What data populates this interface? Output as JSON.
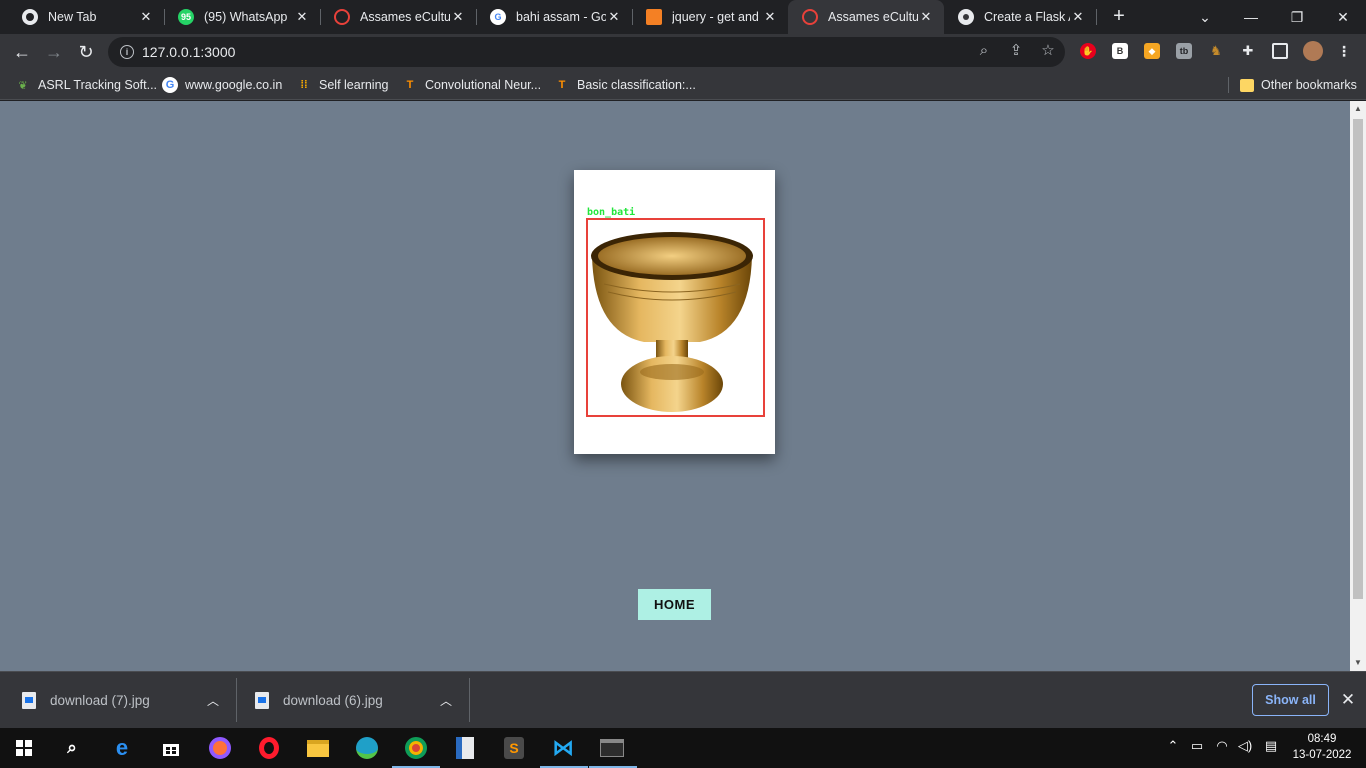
{
  "tabs": [
    {
      "title": "New Tab",
      "icon": "chrome-icon",
      "active": false
    },
    {
      "title": "(95) WhatsApp",
      "icon": "whatsapp-icon",
      "badge": "95",
      "active": false
    },
    {
      "title": "Assames eCultura",
      "icon": "opera-icon",
      "active": false
    },
    {
      "title": "bahi assam - Goo",
      "icon": "google-icon",
      "active": false
    },
    {
      "title": "jquery - get and l",
      "icon": "stackoverflow-icon",
      "active": false
    },
    {
      "title": "Assames eCultura",
      "icon": "opera-icon",
      "active": true
    },
    {
      "title": "Create a Flask Ap",
      "icon": "flask-icon",
      "active": false
    }
  ],
  "address_bar": {
    "url": "127.0.0.1:3000"
  },
  "bookmarks": [
    {
      "label": "ASRL Tracking Soft...",
      "icon": "leaf-icon"
    },
    {
      "label": "www.google.co.in",
      "icon": "google-icon"
    },
    {
      "label": "Self learning",
      "icon": "bars-icon"
    },
    {
      "label": "Convolutional Neur...",
      "icon": "tensorflow-icon"
    },
    {
      "label": "Basic classification:...",
      "icon": "tensorflow-icon"
    }
  ],
  "other_bookmarks": "Other bookmarks",
  "page": {
    "detection_label": "bon_bati",
    "home_button": "HOME",
    "colors": {
      "background": "#6f7d8d",
      "box": "#e8413a",
      "label": "#21e63a",
      "button": "#aef0e4"
    }
  },
  "downloads": {
    "items": [
      {
        "filename": "download (7).jpg"
      },
      {
        "filename": "download (6).jpg"
      }
    ],
    "show_all": "Show all"
  },
  "taskbar": {
    "apps": [
      "windows-start",
      "search",
      "edge-legacy",
      "store",
      "firefox",
      "opera",
      "file-explorer",
      "edge",
      "chrome",
      "libreoffice-writer",
      "sublime-text",
      "vscode",
      "terminal"
    ],
    "time": "08:49",
    "date": "13-07-2022"
  }
}
